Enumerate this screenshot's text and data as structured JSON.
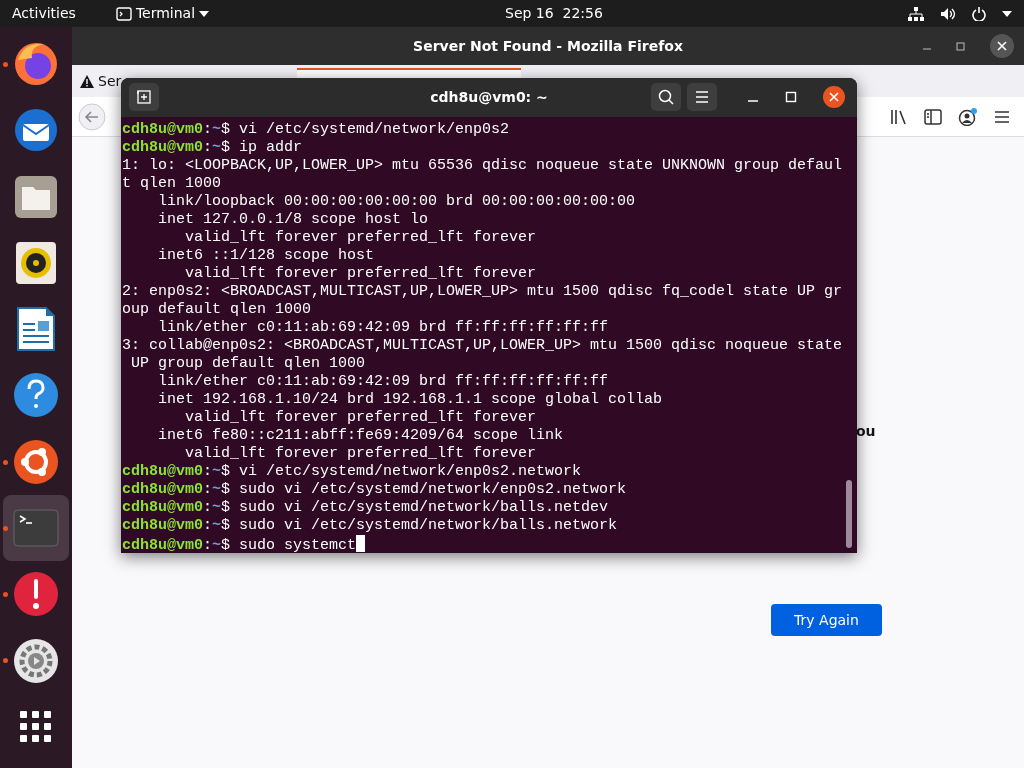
{
  "top_bar": {
    "activities": "Activities",
    "app_menu": "Terminal",
    "clock": "Sep 16  22:56"
  },
  "dock": [
    {
      "kind": "firefox",
      "running": true,
      "selected": false
    },
    {
      "kind": "thunderbird",
      "running": false,
      "selected": false
    },
    {
      "kind": "files",
      "running": false,
      "selected": false
    },
    {
      "kind": "rhythmbox",
      "running": false,
      "selected": false
    },
    {
      "kind": "writer",
      "running": false,
      "selected": false
    },
    {
      "kind": "help",
      "running": false,
      "selected": false
    },
    {
      "kind": "software",
      "running": true,
      "selected": false
    },
    {
      "kind": "terminal",
      "running": true,
      "selected": true
    },
    {
      "kind": "error",
      "running": true,
      "selected": false
    },
    {
      "kind": "settings",
      "running": true,
      "selected": false
    },
    {
      "kind": "apps",
      "running": false,
      "selected": false
    }
  ],
  "firefox": {
    "title": "Server Not Found - Mozilla Firefox",
    "tab_title": "Ser",
    "page_text_fragment": "ou",
    "try_again": "Try Again"
  },
  "terminal": {
    "title": "cdh8u@vm0: ~",
    "cursor": true,
    "lines": [
      {
        "kind": "prompt",
        "user": "cdh8u@vm0",
        "sep": ":",
        "path": "~",
        "command": "$ vi /etc/systemd/network/enp0s2"
      },
      {
        "kind": "prompt",
        "user": "cdh8u@vm0",
        "sep": ":",
        "path": "~",
        "command": "$ ip addr"
      },
      {
        "kind": "output",
        "text": "1: lo: <LOOPBACK,UP,LOWER_UP> mtu 65536 qdisc noqueue state UNKNOWN group defaul"
      },
      {
        "kind": "output",
        "text": "t qlen 1000"
      },
      {
        "kind": "output",
        "text": "    link/loopback 00:00:00:00:00:00 brd 00:00:00:00:00:00"
      },
      {
        "kind": "output",
        "text": "    inet 127.0.0.1/8 scope host lo"
      },
      {
        "kind": "output",
        "text": "       valid_lft forever preferred_lft forever"
      },
      {
        "kind": "output",
        "text": "    inet6 ::1/128 scope host"
      },
      {
        "kind": "output",
        "text": "       valid_lft forever preferred_lft forever"
      },
      {
        "kind": "output",
        "text": "2: enp0s2: <BROADCAST,MULTICAST,UP,LOWER_UP> mtu 1500 qdisc fq_codel state UP gr"
      },
      {
        "kind": "output",
        "text": "oup default qlen 1000"
      },
      {
        "kind": "output",
        "text": "    link/ether c0:11:ab:69:42:09 brd ff:ff:ff:ff:ff:ff"
      },
      {
        "kind": "output",
        "text": "3: collab@enp0s2: <BROADCAST,MULTICAST,UP,LOWER_UP> mtu 1500 qdisc noqueue state"
      },
      {
        "kind": "output",
        "text": " UP group default qlen 1000"
      },
      {
        "kind": "output",
        "text": "    link/ether c0:11:ab:69:42:09 brd ff:ff:ff:ff:ff:ff"
      },
      {
        "kind": "output",
        "text": "    inet 192.168.1.10/24 brd 192.168.1.1 scope global collab"
      },
      {
        "kind": "output",
        "text": "       valid_lft forever preferred_lft forever"
      },
      {
        "kind": "output",
        "text": "    inet6 fe80::c211:abff:fe69:4209/64 scope link"
      },
      {
        "kind": "output",
        "text": "       valid_lft forever preferred_lft forever"
      },
      {
        "kind": "prompt",
        "user": "cdh8u@vm0",
        "sep": ":",
        "path": "~",
        "command": "$ vi /etc/systemd/network/enp0s2.network"
      },
      {
        "kind": "prompt",
        "user": "cdh8u@vm0",
        "sep": ":",
        "path": "~",
        "command": "$ sudo vi /etc/systemd/network/enp0s2.network"
      },
      {
        "kind": "prompt",
        "user": "cdh8u@vm0",
        "sep": ":",
        "path": "~",
        "command": "$ sudo vi /etc/systemd/network/balls.netdev"
      },
      {
        "kind": "prompt",
        "user": "cdh8u@vm0",
        "sep": ":",
        "path": "~",
        "command": "$ sudo vi /etc/systemd/network/balls.network"
      },
      {
        "kind": "prompt",
        "user": "cdh8u@vm0",
        "sep": ":",
        "path": "~",
        "command": "$ sudo systemct"
      }
    ]
  }
}
